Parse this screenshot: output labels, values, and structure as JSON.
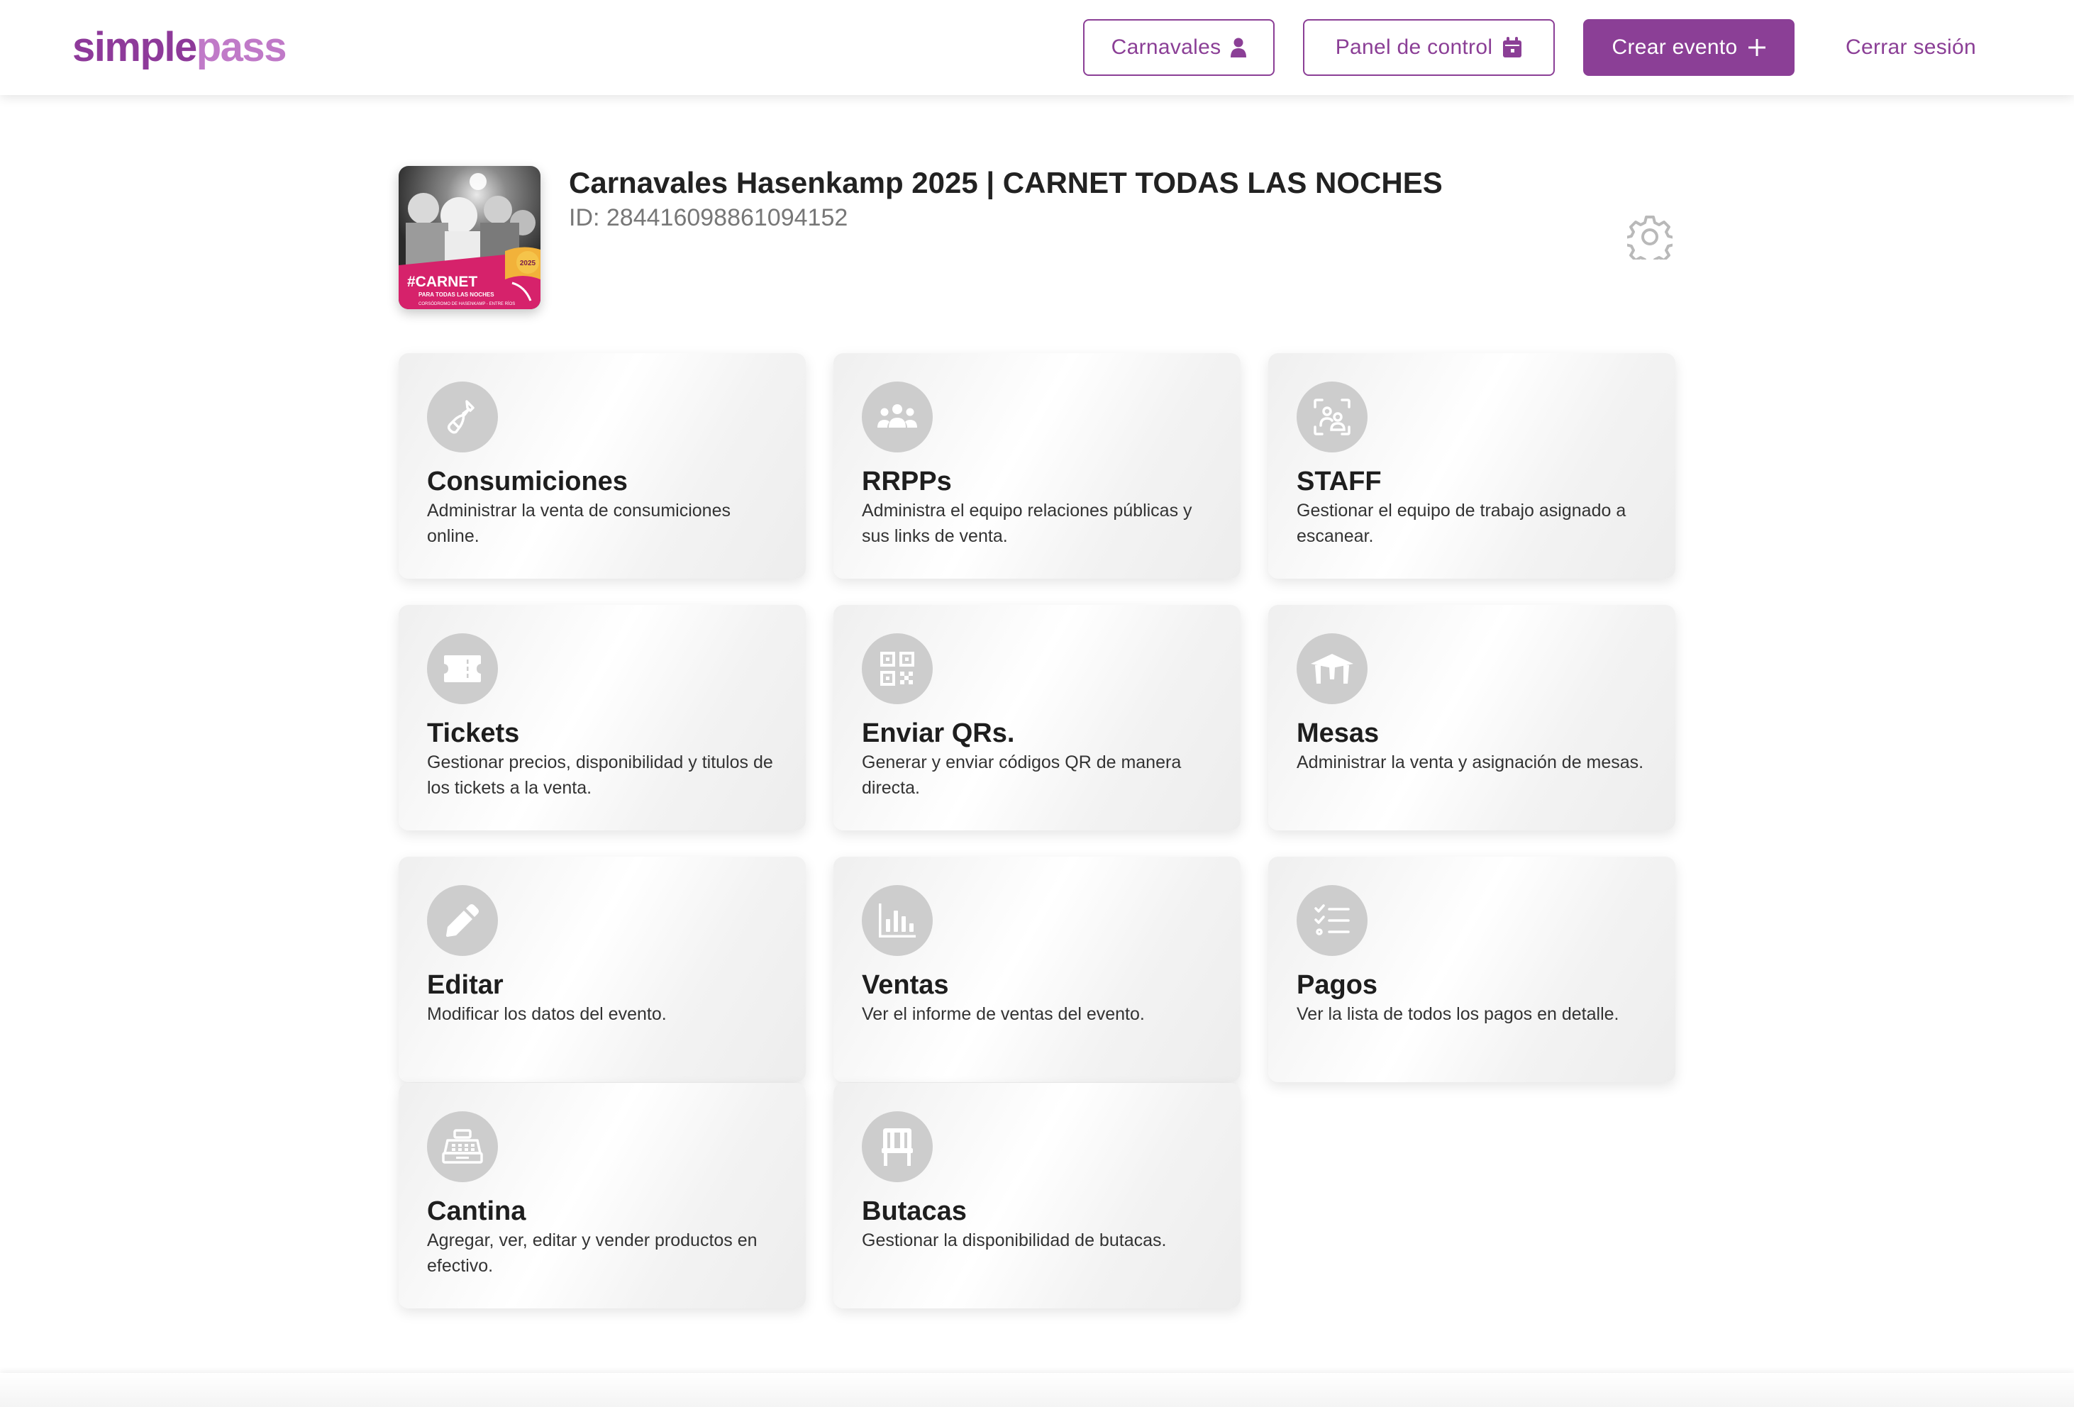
{
  "brand": {
    "part1": "simple",
    "part2": "pass",
    "color_dark": "#8e3a9a",
    "color_light": "#c07ac8"
  },
  "nav": {
    "carnavales": {
      "label": "Carnavales",
      "icon": "user-icon"
    },
    "panel": {
      "label": "Panel de control",
      "icon": "calendar-icon"
    },
    "crear": {
      "label": "Crear evento",
      "icon": "plus-icon"
    },
    "logout": {
      "label": "Cerrar sesión"
    }
  },
  "event": {
    "title": "Carnavales Hasenkamp 2025 | CARNET TODAS LAS NOCHES",
    "id_label": "ID: 284416098861094152",
    "poster": {
      "headline": "#CARNET",
      "subline": "PARA TODAS LAS NOCHES",
      "footer": "CORSÓDROMO DE HASENKAMP - ENTRE RÍOS",
      "badge": "2025"
    },
    "settings_icon": "gear-icon"
  },
  "cards": [
    {
      "title": "Consumiciones",
      "desc": "Administrar la venta de consumiciones online.",
      "icon": "bottle-icon"
    },
    {
      "title": "RRPPs",
      "desc": "Administra el equipo relaciones públicas y sus links de venta.",
      "icon": "people-group-icon"
    },
    {
      "title": "STAFF",
      "desc": "Gestionar el equipo de trabajo asignado a escanear.",
      "icon": "staff-scan-icon"
    },
    {
      "title": "Tickets",
      "desc": "Gestionar precios, disponibilidad y titulos de los tickets a la venta.",
      "icon": "ticket-icon"
    },
    {
      "title": "Enviar QRs.",
      "desc": "Generar y enviar códigos QR de manera directa.",
      "icon": "qr-code-icon"
    },
    {
      "title": "Mesas",
      "desc": "Administrar la venta y asignación de mesas.",
      "icon": "table-icon"
    },
    {
      "title": "Editar",
      "desc": "Modificar los datos del evento.",
      "icon": "pencil-icon"
    },
    {
      "title": "Ventas",
      "desc": "Ver el informe de ventas del evento.",
      "icon": "bar-chart-icon"
    },
    {
      "title": "Pagos",
      "desc": "Ver la lista de todos los pagos en detalle.",
      "icon": "checklist-icon"
    },
    {
      "title": "Cantina",
      "desc": "Agregar, ver, editar y vender productos en efectivo.",
      "icon": "cash-register-icon"
    },
    {
      "title": "Butacas",
      "desc": "Gestionar la disponibilidad de butacas.",
      "icon": "chair-icon"
    }
  ]
}
